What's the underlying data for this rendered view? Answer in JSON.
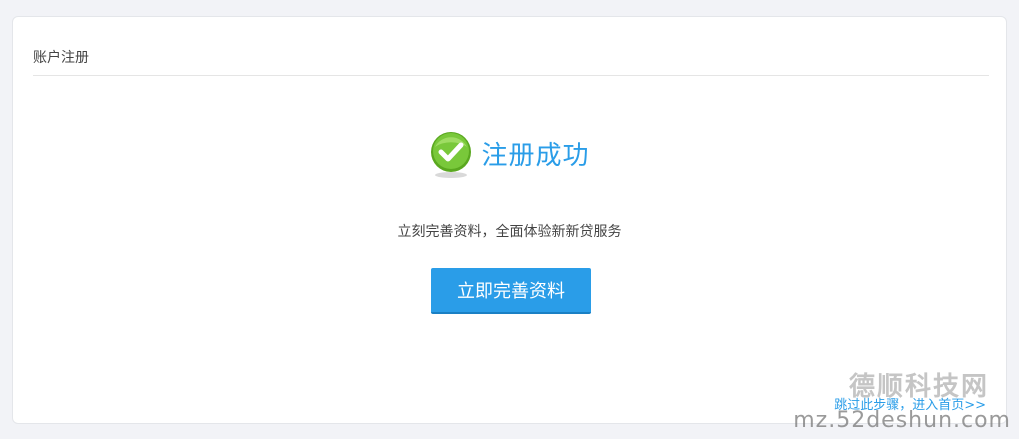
{
  "header": {
    "title": "账户注册"
  },
  "success": {
    "icon": "check-circle-icon",
    "title": "注册成功"
  },
  "subtitle": "立刻完善资料，全面体验新新贷服务",
  "actions": {
    "complete_profile_label": "立即完善资料",
    "skip_label": "跳过此步骤，进入首页>>"
  },
  "watermark": {
    "top_text": "德顺科技网",
    "bottom_text": "mz.52deshun.com"
  },
  "colors": {
    "accent": "#2a9de8",
    "success_green": "#6cbd2a",
    "background": "#f2f3f7"
  }
}
